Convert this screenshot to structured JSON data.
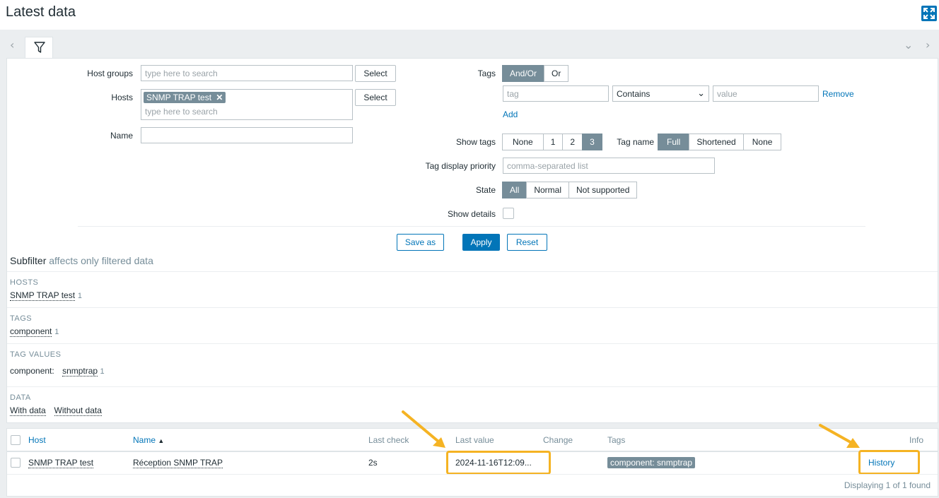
{
  "header": {
    "title": "Latest data"
  },
  "filter": {
    "host_groups": {
      "label": "Host groups",
      "placeholder": "type here to search",
      "select": "Select"
    },
    "hosts": {
      "label": "Hosts",
      "chip": "SNMP TRAP test",
      "placeholder": "type here to search",
      "select": "Select"
    },
    "name": {
      "label": "Name"
    },
    "tags": {
      "label": "Tags",
      "op_and_or": "And/Or",
      "op_or": "Or",
      "tag_placeholder": "tag",
      "operator": "Contains",
      "value_placeholder": "value",
      "remove": "Remove",
      "add": "Add"
    },
    "show_tags": {
      "label": "Show tags",
      "options": [
        "None",
        "1",
        "2",
        "3"
      ],
      "selected": "3"
    },
    "tag_name": {
      "label": "Tag name",
      "options": [
        "Full",
        "Shortened",
        "None"
      ],
      "selected": "Full"
    },
    "tag_priority": {
      "label": "Tag display priority",
      "placeholder": "comma-separated list"
    },
    "state": {
      "label": "State",
      "options": [
        "All",
        "Normal",
        "Not supported"
      ],
      "selected": "All"
    },
    "show_details": {
      "label": "Show details"
    },
    "buttons": {
      "save_as": "Save as",
      "apply": "Apply",
      "reset": "Reset"
    }
  },
  "subfilter": {
    "title": "Subfilter",
    "note": "affects only filtered data",
    "hosts": {
      "heading": "HOSTS",
      "item": "SNMP TRAP test",
      "count": "1"
    },
    "tags": {
      "heading": "TAGS",
      "item": "component",
      "count": "1"
    },
    "tag_values": {
      "heading": "TAG VALUES",
      "key": "component:",
      "item": "snmptrap",
      "count": "1"
    },
    "data": {
      "heading": "DATA",
      "with": "With data",
      "without": "Without data"
    }
  },
  "table": {
    "columns": {
      "host": "Host",
      "name": "Name",
      "last_check": "Last check",
      "last_value": "Last value",
      "change": "Change",
      "tags": "Tags",
      "info": "Info"
    },
    "sort_indicator": "▲",
    "rows": [
      {
        "host": "SNMP TRAP test",
        "name": "Réception SNMP TRAP",
        "last_check": "2s",
        "last_value": "2024-11-16T12:09...",
        "change": "",
        "tag": "component: snmptrap",
        "action": "History"
      }
    ],
    "footer": "Displaying 1 of 1 found"
  }
}
